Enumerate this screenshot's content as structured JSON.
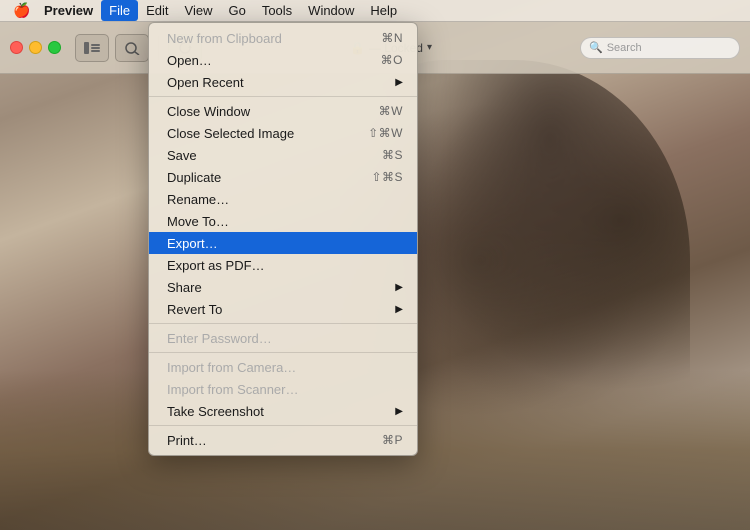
{
  "menubar": {
    "apple": "🍎",
    "items": [
      {
        "label": "Preview",
        "bold": true,
        "active": false
      },
      {
        "label": "File",
        "bold": false,
        "active": true
      },
      {
        "label": "Edit",
        "bold": false,
        "active": false
      },
      {
        "label": "View",
        "bold": false,
        "active": false
      },
      {
        "label": "Go",
        "bold": false,
        "active": false
      },
      {
        "label": "Tools",
        "bold": false,
        "active": false
      },
      {
        "label": "Window",
        "bold": false,
        "active": false
      },
      {
        "label": "Help",
        "bold": false,
        "active": false
      }
    ]
  },
  "toolbar": {
    "locked_label": "— Locked",
    "search_placeholder": "Search"
  },
  "file_menu": {
    "items": [
      {
        "label": "New from Clipboard",
        "shortcut": "⌘N",
        "disabled": true,
        "separator_after": false
      },
      {
        "label": "Open…",
        "shortcut": "⌘O",
        "disabled": false,
        "separator_after": false
      },
      {
        "label": "Open Recent",
        "shortcut": "▶",
        "disabled": false,
        "separator_after": true
      },
      {
        "label": "Close Window",
        "shortcut": "⌘W",
        "disabled": false,
        "separator_after": false
      },
      {
        "label": "Close Selected Image",
        "shortcut": "⇧⌘W",
        "disabled": false,
        "separator_after": false
      },
      {
        "label": "Save",
        "shortcut": "⌘S",
        "disabled": false,
        "separator_after": false
      },
      {
        "label": "Duplicate",
        "shortcut": "⇧⌘S",
        "disabled": false,
        "separator_after": false
      },
      {
        "label": "Rename…",
        "shortcut": "",
        "disabled": false,
        "separator_after": false
      },
      {
        "label": "Move To…",
        "shortcut": "",
        "disabled": false,
        "separator_after": false
      },
      {
        "label": "Export…",
        "shortcut": "",
        "disabled": false,
        "highlighted": true,
        "separator_after": false
      },
      {
        "label": "Export as PDF…",
        "shortcut": "",
        "disabled": false,
        "separator_after": false
      },
      {
        "label": "Share",
        "shortcut": "▶",
        "disabled": false,
        "separator_after": false
      },
      {
        "label": "Revert To",
        "shortcut": "▶",
        "disabled": false,
        "separator_after": true
      },
      {
        "label": "Enter Password…",
        "shortcut": "",
        "disabled": true,
        "separator_after": false
      },
      {
        "label": "",
        "separator": true
      },
      {
        "label": "Import from Camera…",
        "shortcut": "",
        "disabled": true,
        "separator_after": false
      },
      {
        "label": "Import from Scanner…",
        "shortcut": "",
        "disabled": true,
        "separator_after": false
      },
      {
        "label": "Take Screenshot",
        "shortcut": "▶",
        "disabled": false,
        "separator_after": true
      },
      {
        "label": "Print…",
        "shortcut": "⌘P",
        "disabled": false,
        "separator_after": false
      }
    ]
  }
}
